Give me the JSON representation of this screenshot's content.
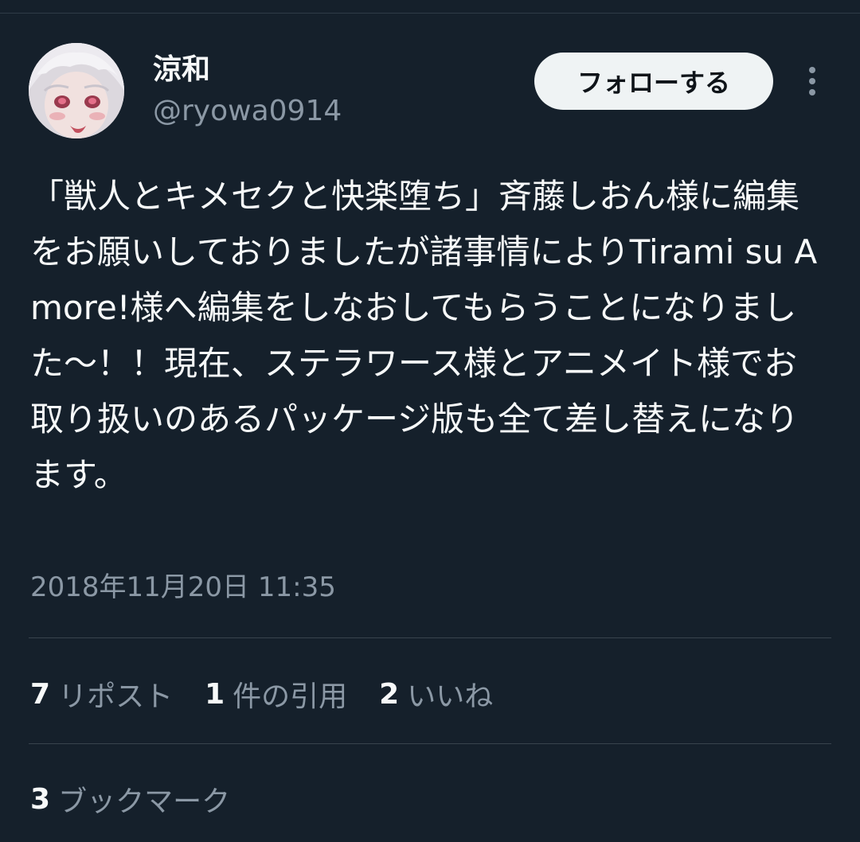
{
  "author": {
    "display_name": "涼和",
    "handle": "@ryowa0914"
  },
  "follow_button": {
    "label": "フォローする"
  },
  "tweet": {
    "text": "「獣人とキメセクと快楽堕ち」斉藤しおん様に編集をお願いしておりましたが諸事情によりTirami su Amore!様へ編集をしなおしてもらうことになりました～！！現在、ステラワース様とアニメイト様でお取り扱いのあるパッケージ版も全て差し替えになります。",
    "timestamp": "2018年11月20日 11:35"
  },
  "stats": {
    "reposts": {
      "count": "7",
      "label": "リポスト"
    },
    "quotes": {
      "count": "1",
      "label": "件の引用"
    },
    "likes": {
      "count": "2",
      "label": "いいね"
    },
    "bookmarks": {
      "count": "3",
      "label": "ブックマーク"
    }
  },
  "colors": {
    "background": "#15202b",
    "primary_text": "#f7f9f9",
    "secondary_text": "#8b98a5",
    "button_bg": "#eff3f4",
    "divider": "#38444d"
  },
  "icons": {
    "more": "more-vertical-icon"
  }
}
